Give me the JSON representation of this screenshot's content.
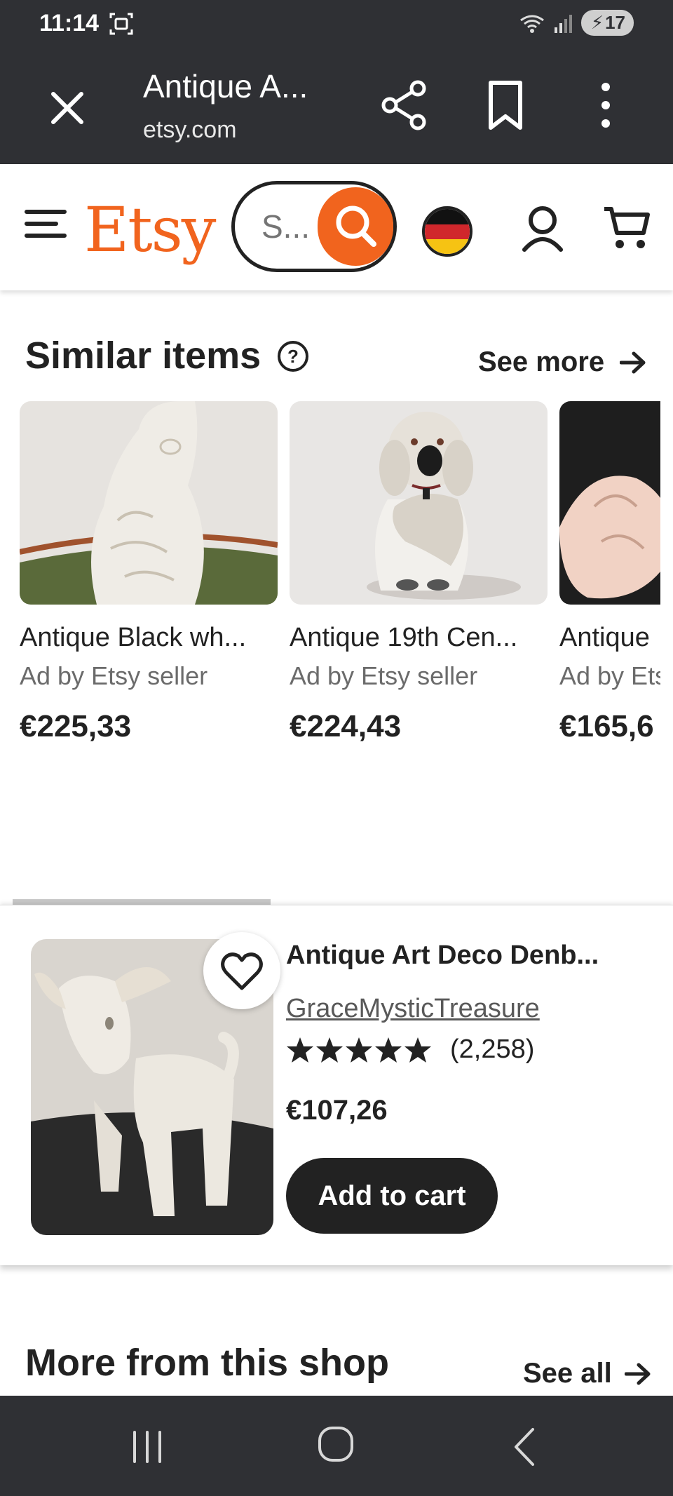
{
  "status_bar": {
    "time": "11:14",
    "battery": "17"
  },
  "browser": {
    "title": "Antique A...",
    "url": "etsy.com"
  },
  "header": {
    "logo": "Etsy",
    "search_placeholder": "S..."
  },
  "similar": {
    "title": "Similar items",
    "see_more": "See more",
    "items": [
      {
        "title": "Antique Black wh...",
        "seller": "Ad by Etsy seller",
        "price": "€225,33"
      },
      {
        "title": "Antique 19th Cen...",
        "seller": "Ad by Etsy seller",
        "price": "€224,43"
      },
      {
        "title": "Antique",
        "seller": "Ad by Etsy seller",
        "price": "€165,6"
      }
    ]
  },
  "featured": {
    "title": "Antique Art Deco Denb...",
    "shop": "GraceMysticTreasure",
    "rating_stars": 5,
    "review_count": "(2,258)",
    "price": "€107,26",
    "add_to_cart": "Add to cart"
  },
  "more_from_shop": {
    "title": "More from this shop",
    "see_all": "See all"
  },
  "colors": {
    "etsy_orange": "#f1641e",
    "dark": "#222222",
    "chrome": "#2f3034"
  }
}
